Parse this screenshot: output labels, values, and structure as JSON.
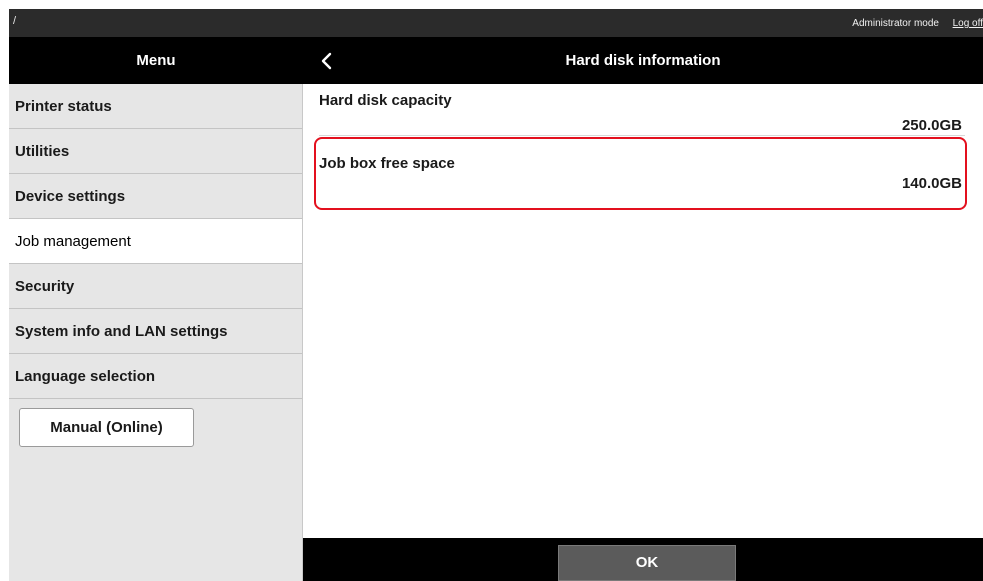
{
  "top_bar": {
    "mark": "/",
    "mode_label": "Administrator mode",
    "logoff_label": "Log off"
  },
  "header": {
    "menu_title": "Menu",
    "back_icon": "chevron-left-icon",
    "page_title": "Hard disk information"
  },
  "sidebar": {
    "items": [
      {
        "label": "Printer status",
        "selected": false
      },
      {
        "label": "Utilities",
        "selected": false
      },
      {
        "label": "Device settings",
        "selected": false
      },
      {
        "label": "Job management",
        "selected": true
      },
      {
        "label": "Security",
        "selected": false
      },
      {
        "label": "System info and LAN settings",
        "selected": false
      },
      {
        "label": "Language selection",
        "selected": false
      }
    ],
    "manual_button": "Manual (Online)"
  },
  "main": {
    "rows": [
      {
        "label": "Hard disk capacity",
        "value": "250.0GB"
      },
      {
        "label": "Job box free space",
        "value": "140.0GB"
      }
    ],
    "highlight_color": "#e3101e"
  },
  "footer": {
    "ok_label": "OK"
  }
}
